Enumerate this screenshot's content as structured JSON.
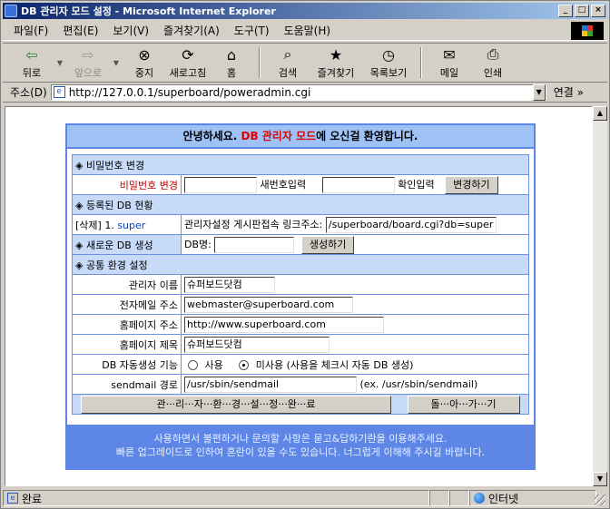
{
  "window": {
    "title": "DB 관리자 모드 설정 - Microsoft Internet Explorer",
    "buttons": {
      "minimize": "_",
      "maximize": "□",
      "close": "×"
    }
  },
  "menu": [
    "파일(F)",
    "편집(E)",
    "보기(V)",
    "즐겨찾기(A)",
    "도구(T)",
    "도움말(H)"
  ],
  "toolbar": {
    "back": "뒤로",
    "forward": "앞으로",
    "stop": "중지",
    "refresh": "새로고침",
    "home": "홈",
    "search": "검색",
    "favorites": "즐겨찾기",
    "history": "목록보기",
    "mail": "메일",
    "print": "인쇄"
  },
  "address": {
    "label": "주소(D)",
    "url": "http://127.0.0.1/superboard/poweradmin.cgi",
    "links": "연결 »"
  },
  "admin": {
    "heading_pre": "안녕하세요. ",
    "heading_em": "DB 관리자 모드",
    "heading_post": "에 오신걸 환영합니다.",
    "pw": {
      "section": "◈ 비밀번호 변경",
      "label": "비밀번호 변경",
      "new_label": "새번호입력",
      "confirm_label": "확인입력",
      "button": "변경하기"
    },
    "db": {
      "section": "◈ 등록된 DB 현황",
      "item_prefix": "[삭제] 1. ",
      "item_name": "super",
      "links_text": "관리자설정 게시판접속 링크주소:",
      "link_value": "/superboard/board.cgi?db=super"
    },
    "newdb": {
      "section": "◈ 새로운 DB 생성",
      "label": "DB명:",
      "button": "생성하기"
    },
    "env": {
      "section": "◈ 공통 환경 설정",
      "admin_name_label": "관리자 이름",
      "admin_name_value": "슈퍼보드닷컴",
      "email_label": "전자메일 주소",
      "email_value": "webmaster@superboard.com",
      "homepage_label": "홈페이지 주소",
      "homepage_value": "http://www.superboard.com",
      "title_label": "홈페이지 제목",
      "title_value": "슈퍼보드닷컴",
      "autodb_label": "DB 자동생성 기능",
      "autodb_use": "사용",
      "autodb_nouse": "미사용 (사용을 체크시 자동 DB 생성)",
      "sendmail_label": "sendmail 경로",
      "sendmail_value": "/usr/sbin/sendmail",
      "sendmail_hint": "(ex. /usr/sbin/sendmail)"
    },
    "done_button": "관···리···자···환···경···설···정···완···료",
    "back_button": "돌···아···가···기",
    "footer_line1": "사용하면서 불편하거나 문의할 사항은 묻고&답하기란을 이용해주세요.",
    "footer_line2": "빠른 업그레이드로 인하여 혼란이 있을 수도 있습니다. 너그럽게 이해해 주시길 바랍니다."
  },
  "status": {
    "text": "완료",
    "zone": "인터넷"
  }
}
